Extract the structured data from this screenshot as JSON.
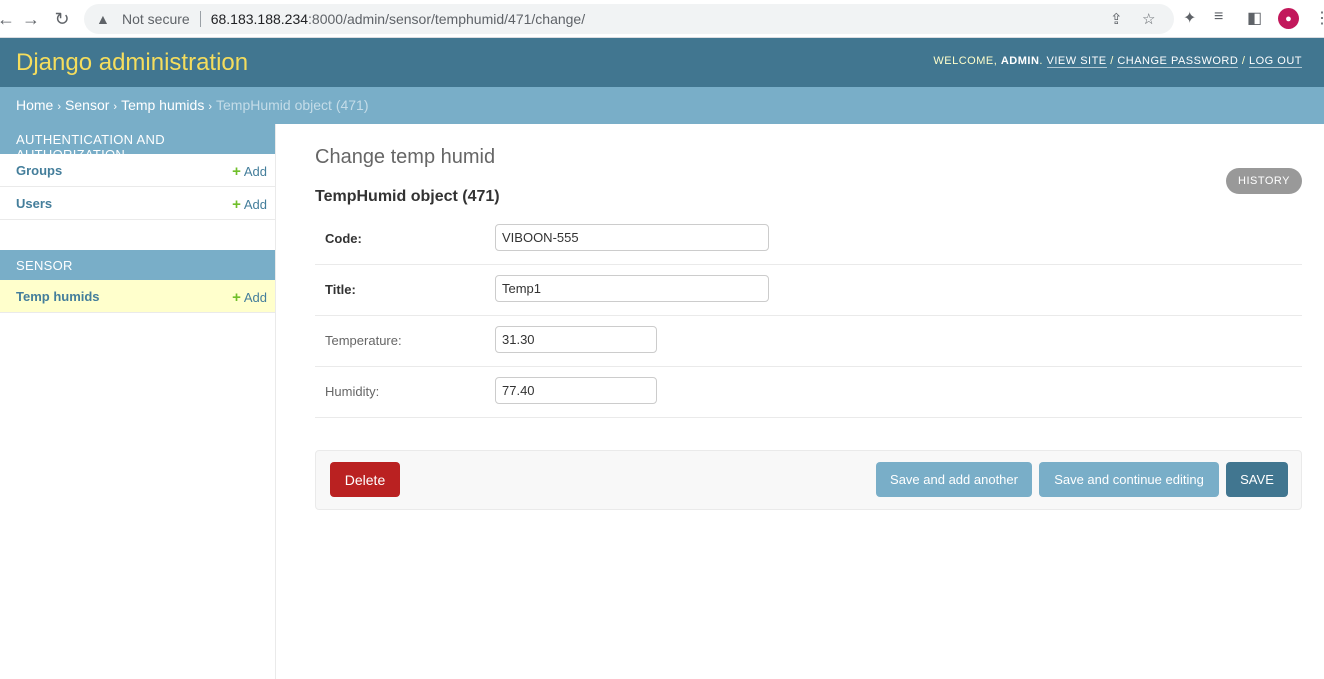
{
  "browser": {
    "security_label": "Not secure",
    "url_host": "68.183.188.234",
    "url_rest": ":8000/admin/sensor/temphumid/471/change/"
  },
  "header": {
    "brand": "Django administration",
    "welcome": "Welcome,",
    "user": "admin",
    "view_site": "View site",
    "change_password": "Change password",
    "log_out": "Log out"
  },
  "breadcrumbs": {
    "home": "Home",
    "app": "Sensor",
    "model": "Temp humids",
    "current": "TempHumid object (471)"
  },
  "sidebar": {
    "modules": [
      {
        "caption": "AUTHENTICATION AND AUTHORIZATION",
        "rows": [
          {
            "name": "Groups",
            "add": "Add"
          },
          {
            "name": "Users",
            "add": "Add"
          }
        ]
      },
      {
        "caption": "SENSOR",
        "rows": [
          {
            "name": "Temp humids",
            "add": "Add"
          }
        ]
      }
    ]
  },
  "content": {
    "page_title": "Change temp humid",
    "history": "HISTORY",
    "object_title": "TempHumid object (471)",
    "fields": [
      {
        "label": "Code:",
        "value": "VIBOON-555"
      },
      {
        "label": "Title:",
        "value": "Temp1"
      },
      {
        "label": "Temperature:",
        "value": "31.30"
      },
      {
        "label": "Humidity:",
        "value": "77.40"
      }
    ],
    "buttons": {
      "delete": "Delete",
      "save_add_another": "Save and add another",
      "save_continue": "Save and continue editing",
      "save": "SAVE"
    }
  },
  "colors": {
    "header_bg": "#417690",
    "brand": "#f5dd5d",
    "breadcrumb_bg": "#79aec8",
    "delete": "#ba2121",
    "add_plus": "#70bf2b"
  }
}
